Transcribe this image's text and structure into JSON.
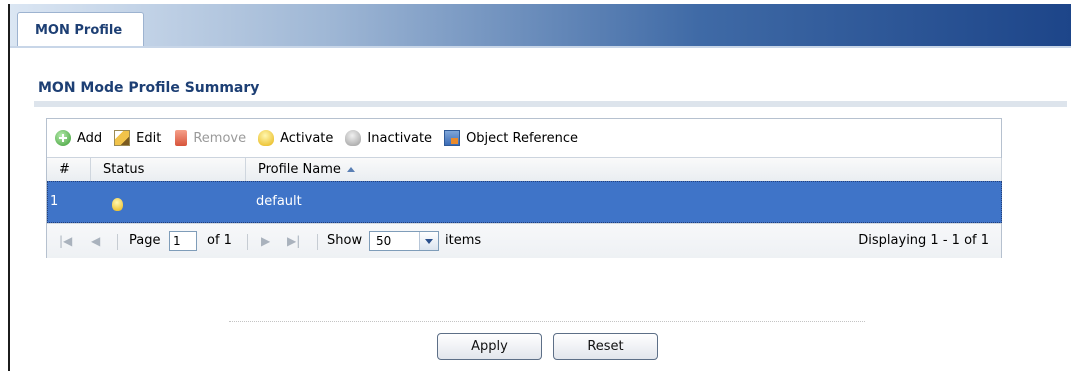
{
  "tabs": [
    {
      "label": "MON Profile"
    }
  ],
  "section": {
    "title": "MON Mode Profile Summary"
  },
  "toolbar": {
    "add": "Add",
    "edit": "Edit",
    "remove": "Remove",
    "activate": "Activate",
    "inactivate": "Inactivate",
    "object_reference": "Object Reference"
  },
  "table": {
    "columns": [
      "#",
      "Status",
      "Profile Name"
    ],
    "rows": [
      {
        "index": "1",
        "status": "active",
        "profile_name": "default"
      }
    ]
  },
  "pager": {
    "page_label": "Page",
    "page_value": "1",
    "of_label": "of 1",
    "show_label": "Show",
    "show_value": "50",
    "items_label": "items",
    "display_text": "Displaying 1 - 1 of 1"
  },
  "buttons": {
    "apply": "Apply",
    "reset": "Reset"
  },
  "colors": {
    "selected_row": "#3f74c8",
    "title": "#1d3f74"
  }
}
